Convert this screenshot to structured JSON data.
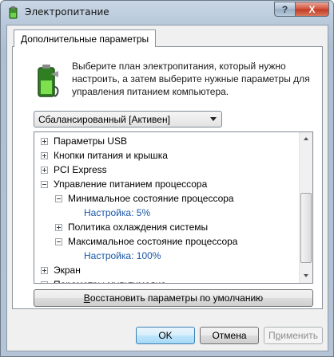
{
  "window": {
    "title": "Электропитание",
    "help_label": "?",
    "close_label": "X"
  },
  "tab": {
    "label": "Дополнительные параметры"
  },
  "intro": {
    "text": "Выберите план электропитания, который нужно настроить, а затем выберите нужные параметры для управления питанием компьютера."
  },
  "plan_select": {
    "value": "Сбалансированный [Активен]"
  },
  "tree": {
    "items": [
      {
        "label": "Параметры USB",
        "level": 0,
        "expander": "plus"
      },
      {
        "label": "Кнопки питания и крышка",
        "level": 0,
        "expander": "plus"
      },
      {
        "label": "PCI Express",
        "level": 0,
        "expander": "plus"
      },
      {
        "label": "Управление питанием процессора",
        "level": 0,
        "expander": "minus"
      },
      {
        "label": "Минимальное состояние процессора",
        "level": 1,
        "expander": "minus"
      },
      {
        "label": "Настройка:",
        "value": "5%",
        "level": 2,
        "expander": "none"
      },
      {
        "label": "Политика охлаждения системы",
        "level": 1,
        "expander": "plus"
      },
      {
        "label": "Максимальное состояние процессора",
        "level": 1,
        "expander": "minus"
      },
      {
        "label": "Настройка:",
        "value": "100%",
        "level": 2,
        "expander": "none"
      },
      {
        "label": "Экран",
        "level": 0,
        "expander": "plus"
      },
      {
        "label": "Параметры мультимедиа",
        "level": 0,
        "expander": "plus"
      }
    ]
  },
  "buttons": {
    "restore": {
      "label_pre": "",
      "label_u": "В",
      "label_post": "осстановить параметры по умолчанию"
    },
    "ok": "OK",
    "cancel": "Отмена",
    "apply": {
      "label_pre": "П",
      "label_u": "р",
      "label_post": "именить"
    }
  },
  "colors": {
    "link": "#1a56a8",
    "ok_border": "#3c7fb1"
  }
}
